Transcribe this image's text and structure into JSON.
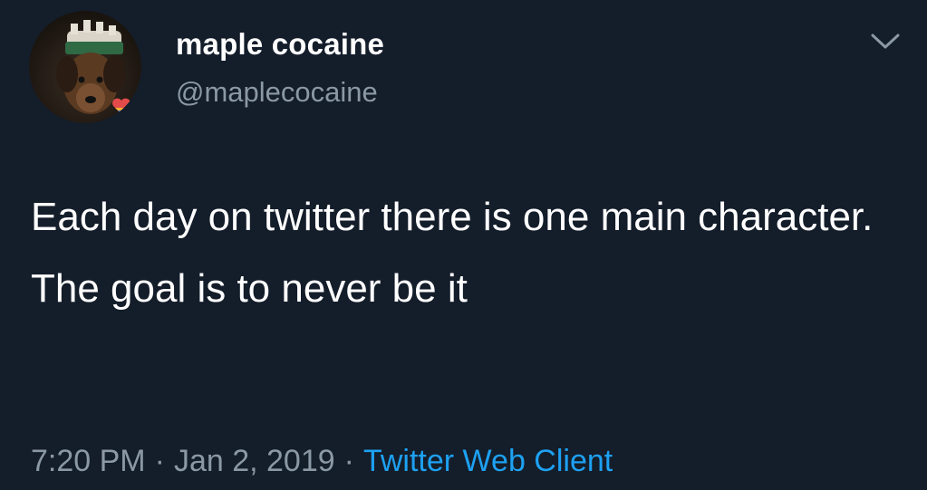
{
  "tweet": {
    "author": {
      "display_name": "maple cocaine",
      "handle": "@maplecocaine"
    },
    "text": "Each day on twitter there is one main character. The goal is to never be it",
    "time": "7:20 PM",
    "separator": "·",
    "date": "Jan 2, 2019",
    "client": "Twitter Web Client",
    "menu_icon": "chevron-down-icon"
  },
  "colors": {
    "background": "#141d2a",
    "primary_text": "#ffffff",
    "secondary_text": "#8b98a5",
    "link": "#1da1f2"
  }
}
